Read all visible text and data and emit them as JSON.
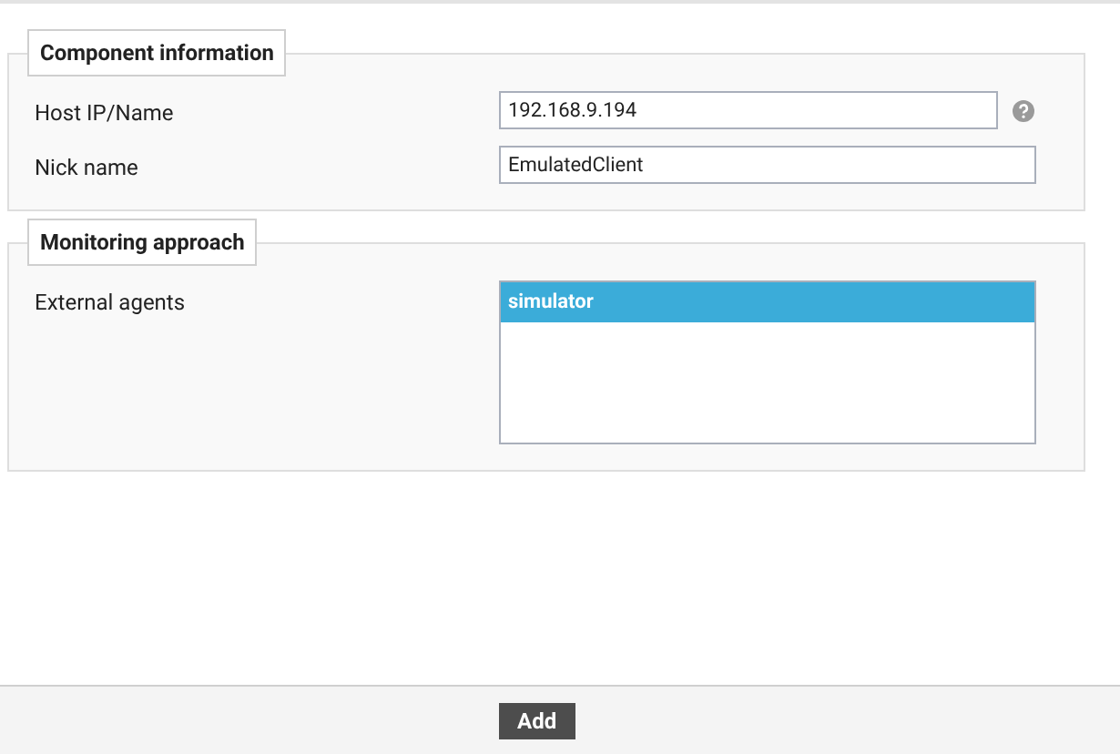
{
  "sections": [
    {
      "title": "Component information",
      "fields": [
        {
          "kind": "text",
          "label": "Host IP/Name",
          "value": "192.168.9.194",
          "help": true
        },
        {
          "kind": "text",
          "label": "Nick name",
          "value": "EmulatedClient",
          "help": false
        }
      ]
    },
    {
      "title": "Monitoring approach",
      "fields": [
        {
          "kind": "list",
          "label": "External agents",
          "options": [
            {
              "label": "simulator",
              "selected": true
            }
          ]
        }
      ]
    }
  ],
  "footer": {
    "button": "Add"
  }
}
